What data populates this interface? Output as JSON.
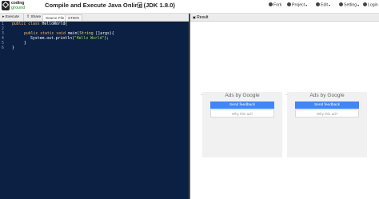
{
  "app": {
    "logo_line1": "coding",
    "logo_line2": "ground",
    "title": "Compile and Execute Java Online (JDK 1.8.0)"
  },
  "menu": {
    "fork": "Fork",
    "project": "Project",
    "edit": "Edit",
    "setting": "Setting",
    "login": "Login"
  },
  "toolbar": {
    "execute": "Execute",
    "share": "Share",
    "tabs": [
      "Source File",
      "STDIN"
    ]
  },
  "editor": {
    "line_numbers": [
      "1",
      "2",
      "3",
      "4",
      "5",
      "6"
    ],
    "line1_kw": "public class",
    "line1_rest": " HelloWorld{",
    "line3_kw": "public static void",
    "line3_mid": " main(",
    "line3_ty": "String",
    "line3_rest": " []args){",
    "line4_pre": "System.out.println(",
    "line4_str": "\"Hello World\"",
    "line4_post": ");",
    "line5": "}",
    "line6": "}"
  },
  "result": {
    "title": "Result"
  },
  "ads": {
    "title": "Ads by Google",
    "send_feedback": "Send feedback",
    "why_this_ad": "Why this ad?"
  },
  "colors": {
    "editor_bg": "#0b2042",
    "ad_button": "#4285f4",
    "keyword": "#ffb86c",
    "string": "#a6e22e"
  }
}
